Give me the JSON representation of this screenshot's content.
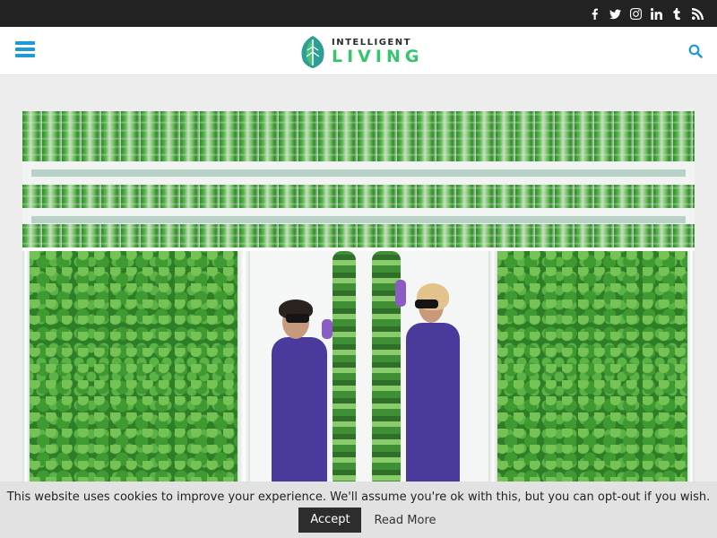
{
  "topbar": {
    "social_icons": [
      "facebook-icon",
      "twitter-icon",
      "instagram-icon",
      "linkedin-icon",
      "tumblr-icon",
      "rss-icon"
    ],
    "background": "#222222"
  },
  "header": {
    "logo_top": "INTELLIGENT",
    "logo_bottom": "LIVING",
    "accent_color": "#1e9ad6",
    "logo_color": "#36c46f"
  },
  "hero": {
    "image_alt_icon": "vertical-farm-photo"
  },
  "cookie_bar": {
    "message": "This website uses cookies to improve your experience. We'll assume you're ok with this, but you can opt-out if you wish.",
    "accept_label": "Accept",
    "read_more_label": "Read More"
  }
}
